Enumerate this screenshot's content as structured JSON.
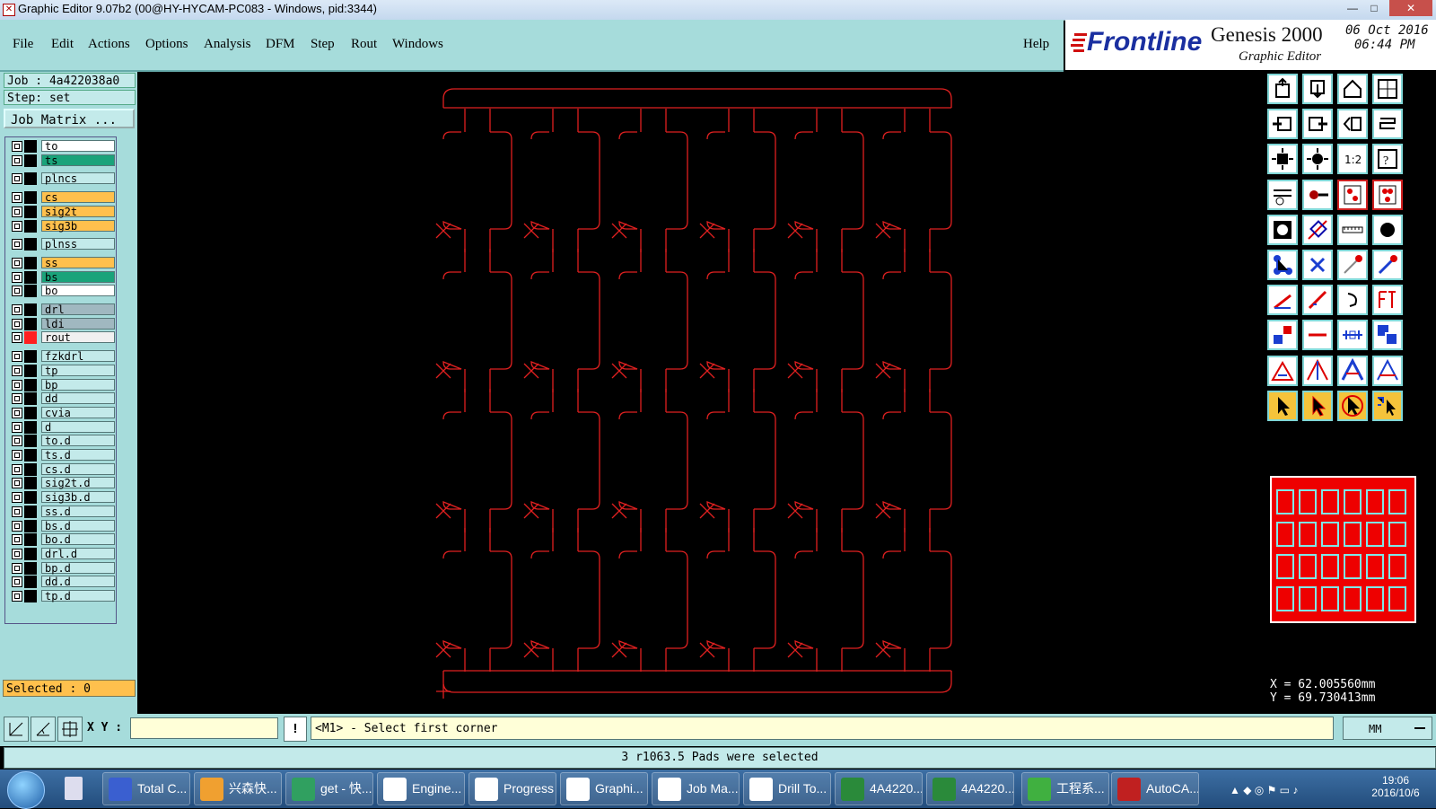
{
  "window": {
    "title": "Graphic Editor 9.07b2 (00@HY-HYCAM-PC083 - Windows, pid:3344)",
    "minimize": "—",
    "maximize": "□",
    "close": "✕"
  },
  "menu": {
    "items": [
      "File",
      "Edit",
      "Actions",
      "Options",
      "Analysis",
      "DFM",
      "Step",
      "Rout",
      "Windows"
    ],
    "help": "Help"
  },
  "brand": {
    "logo": "Frontline",
    "product": "Genesis 2000",
    "subtitle": "Graphic Editor",
    "date": "06 Oct 2016",
    "time": "06:44 PM"
  },
  "job": {
    "job_line": "Job : 4a422038a0",
    "step_line": "Step: set",
    "matrix_button": "Job Matrix ...",
    "selected": "Selected : 0"
  },
  "layers": [
    {
      "name": "to",
      "color": "#ffffff",
      "swatch": "#000000"
    },
    {
      "name": "ts",
      "color": "#1aa37a",
      "swatch": "#000000"
    },
    {
      "name": "plncs",
      "color": "#c3eaea",
      "swatch": "#000000"
    },
    {
      "name": "cs",
      "color": "#ffc04d",
      "swatch": "#000000"
    },
    {
      "name": "sig2t",
      "color": "#ffc04d",
      "swatch": "#000000"
    },
    {
      "name": "sig3b",
      "color": "#ffc04d",
      "swatch": "#000000"
    },
    {
      "name": "plnss",
      "color": "#c3eaea",
      "swatch": "#000000"
    },
    {
      "name": "ss",
      "color": "#ffc04d",
      "swatch": "#000000"
    },
    {
      "name": "bs",
      "color": "#1aa37a",
      "swatch": "#000000"
    },
    {
      "name": "bo",
      "color": "#ffffff",
      "swatch": "#000000"
    },
    {
      "name": "drl",
      "color": "#a0b8c0",
      "swatch": "#000000"
    },
    {
      "name": "ldi",
      "color": "#a0b8c0",
      "swatch": "#000000"
    },
    {
      "name": "rout",
      "color": "#f0f0f0",
      "swatch": "#ff2020",
      "active": true
    },
    {
      "name": "fzkdrl",
      "color": "#c3eaea",
      "swatch": "#000000"
    },
    {
      "name": "tp",
      "color": "#c3eaea",
      "swatch": "#000000"
    },
    {
      "name": "bp",
      "color": "#c3eaea",
      "swatch": "#000000"
    },
    {
      "name": "dd",
      "color": "#c3eaea",
      "swatch": "#000000"
    },
    {
      "name": "cvia",
      "color": "#c3eaea",
      "swatch": "#000000"
    },
    {
      "name": "d",
      "color": "#c3eaea",
      "swatch": "#000000"
    },
    {
      "name": "to.d",
      "color": "#c3eaea",
      "swatch": "#000000"
    },
    {
      "name": "ts.d",
      "color": "#c3eaea",
      "swatch": "#000000"
    },
    {
      "name": "cs.d",
      "color": "#c3eaea",
      "swatch": "#000000"
    },
    {
      "name": "sig2t.d",
      "color": "#c3eaea",
      "swatch": "#000000"
    },
    {
      "name": "sig3b.d",
      "color": "#c3eaea",
      "swatch": "#000000"
    },
    {
      "name": "ss.d",
      "color": "#c3eaea",
      "swatch": "#000000"
    },
    {
      "name": "bs.d",
      "color": "#c3eaea",
      "swatch": "#000000"
    },
    {
      "name": "bo.d",
      "color": "#c3eaea",
      "swatch": "#000000"
    },
    {
      "name": "drl.d",
      "color": "#c3eaea",
      "swatch": "#000000"
    },
    {
      "name": "bp.d",
      "color": "#c3eaea",
      "swatch": "#000000"
    },
    {
      "name": "dd.d",
      "color": "#c3eaea",
      "swatch": "#000000"
    },
    {
      "name": "tp.d",
      "color": "#c3eaea",
      "swatch": "#000000"
    }
  ],
  "coords": {
    "x": "X =  62.005560mm",
    "y": "Y =  69.730413mm"
  },
  "bottom": {
    "xy_label": "X Y :",
    "xy_value": "",
    "prompt": "<M1> - Select first corner",
    "units": "MM"
  },
  "status": "3 r1063.5 Pads were selected",
  "taskbar": {
    "items": [
      "Total C...",
      "兴森快...",
      "get - 快...",
      "Engine...",
      "Progress",
      "Graphi...",
      "Job Ma...",
      "Drill To...",
      "4A4220...",
      "4A4220...",
      "工程系...",
      "AutoCA..."
    ],
    "clock_time": "19:06",
    "clock_date": "2016/10/6"
  },
  "colors": {
    "panel": "#a6dcdb",
    "rout_outline": "#e02020",
    "canvas": "#000000"
  }
}
